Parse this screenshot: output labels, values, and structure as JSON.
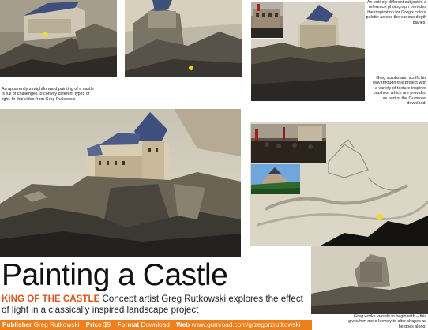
{
  "captions": {
    "top_left": "An apparently straightforward painting of a castle is full of challenges to convey different types of light. In this video from Greg Rutkowski",
    "top_right": "An entirely different subject in a reference photograph provides the inspiration for Greg's colour palette across the various depth planes.",
    "mid_right": "Greg scrubs and scuffs his way through this project with a variety of texture-inspired brushes, which are provided as part of the Gumroad download.",
    "bottom_right": "Greg works loosely to begin with – this gives him more leeway to alter shapes as he goes along."
  },
  "headline": {
    "title": "Painting a Castle",
    "kicker": "KING OF THE CASTLE",
    "standfirst": " Concept artist Greg Rutkowski explores the effect of light in a classically inspired landscape project"
  },
  "infobar": {
    "publisher_label": "Publisher",
    "publisher_value": "Greg Rutkowski",
    "price_label": "Price",
    "price_value": "$9",
    "format_label": "Format",
    "format_value": "Download",
    "web_label": "Web",
    "web_value": "www.gumroad.com/grzegorzrutkowski"
  },
  "colors": {
    "accent_orange": "#ef7f1a",
    "kicker_orange": "#d8571e",
    "castle_roof_blue": "#3f4f7d"
  }
}
